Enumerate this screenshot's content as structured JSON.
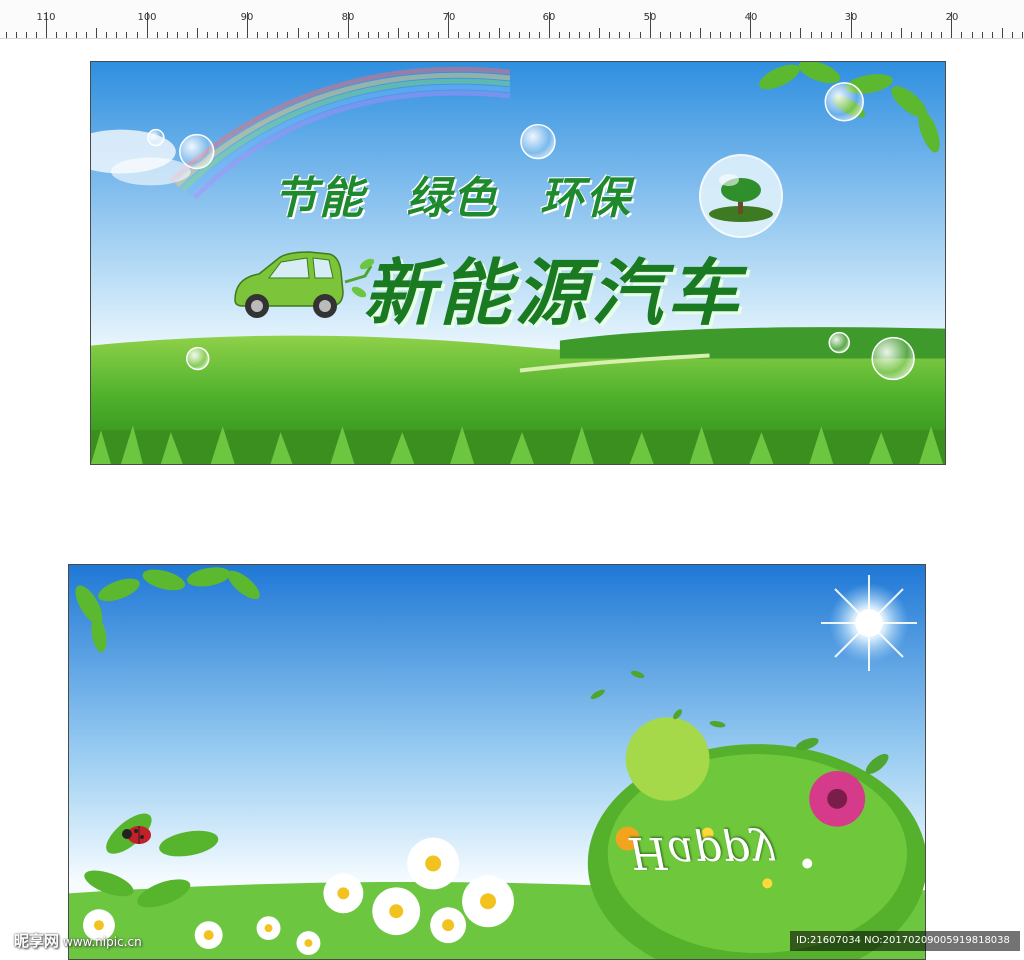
{
  "ruler": {
    "labels": [
      "110",
      "100",
      "90",
      "80",
      "70",
      "60",
      "50",
      "40",
      "30",
      "20"
    ]
  },
  "banner1": {
    "subtitle_words": [
      "节能",
      "绿色",
      "环保"
    ],
    "title": "新能源汽车"
  },
  "banner2": {
    "decor_text": "Happy"
  },
  "watermark": {
    "brand": "昵享网",
    "site": "www.nipic.cn",
    "id_text": "ID:21607034 NO:20170209005919818038"
  },
  "colors": {
    "title_green": "#1a7a22",
    "sky_blue": "#2f8fe0",
    "grass_green": "#4caf2a"
  },
  "icons": [
    "ladybug-icon",
    "sun-icon",
    "car-icon",
    "tree-bubble-icon"
  ]
}
